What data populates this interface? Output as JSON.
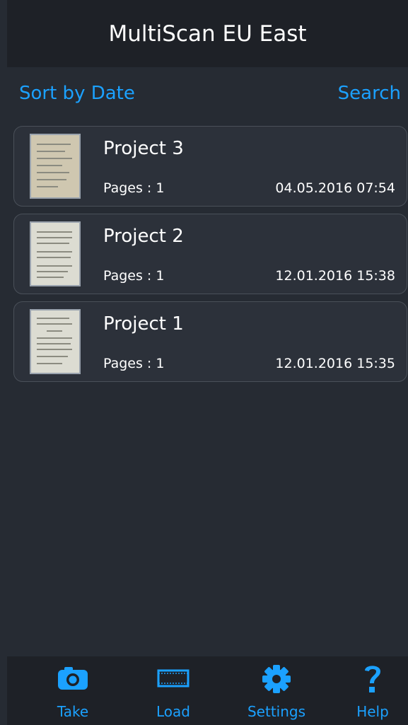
{
  "header": {
    "title": "MultiScan EU East"
  },
  "toolbar": {
    "sort_label": "Sort by Date",
    "search_label": "Search"
  },
  "projects": [
    {
      "name": "Project 3",
      "pages": "Pages : 1",
      "date": "04.05.2016 07:54"
    },
    {
      "name": "Project 2",
      "pages": "Pages : 1",
      "date": "12.01.2016 15:38"
    },
    {
      "name": "Project 1",
      "pages": "Pages : 1",
      "date": "12.01.2016 15:35"
    }
  ],
  "tabs": [
    {
      "label": "Take",
      "icon": "camera-icon"
    },
    {
      "label": "Load",
      "icon": "film-strip-icon"
    },
    {
      "label": "Settings",
      "icon": "gear-icon"
    },
    {
      "label": "Help",
      "icon": "question-mark-icon"
    }
  ],
  "colors": {
    "accent": "#1ba1ff",
    "background": "#262b33",
    "bar": "#1e2127",
    "card": "#2c313a"
  }
}
